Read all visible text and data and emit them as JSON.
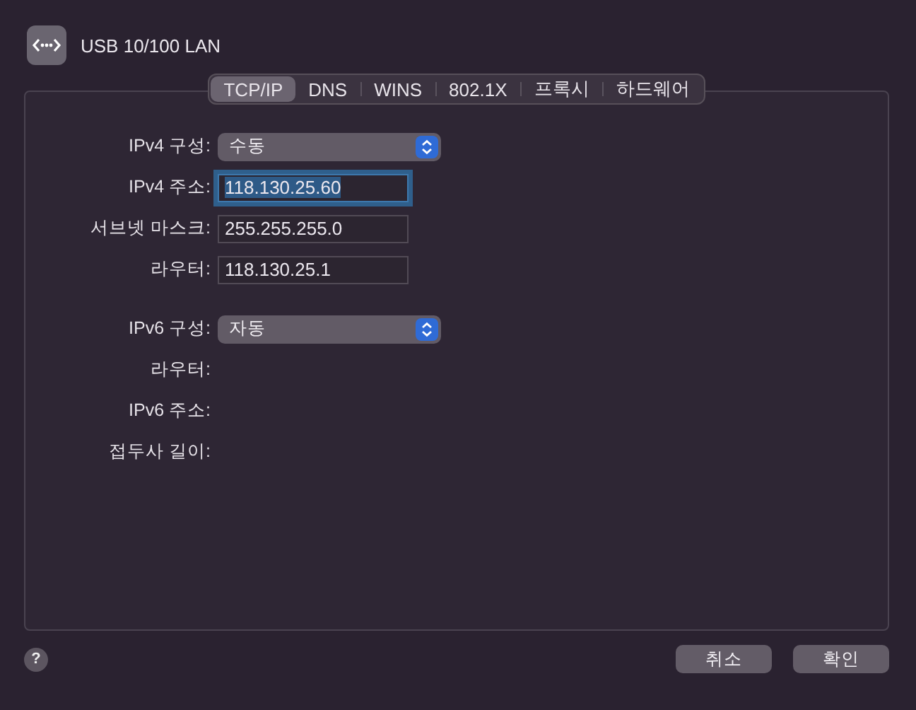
{
  "window": {
    "title": "USB 10/100 LAN"
  },
  "tabs": [
    {
      "label": "TCP/IP",
      "selected": true
    },
    {
      "label": "DNS",
      "selected": false
    },
    {
      "label": "WINS",
      "selected": false
    },
    {
      "label": "802.1X",
      "selected": false
    },
    {
      "label": "프록시",
      "selected": false
    },
    {
      "label": "하드웨어",
      "selected": false
    }
  ],
  "sections": [
    {
      "rows": [
        {
          "kind": "popup",
          "label": "IPv4 구성:",
          "value": "수동"
        },
        {
          "kind": "field",
          "label": "IPv4 주소:",
          "value": "118.130.25.60",
          "focused": true
        },
        {
          "kind": "field",
          "label": "서브넷 마스크:",
          "value": "255.255.255.0",
          "focused": false
        },
        {
          "kind": "field",
          "label": "라우터:",
          "value": "118.130.25.1",
          "focused": false
        }
      ]
    },
    {
      "rows": [
        {
          "kind": "popup",
          "label": "IPv6 구성:",
          "value": "자동"
        },
        {
          "kind": "info",
          "label": "라우터:"
        },
        {
          "kind": "info",
          "label": "IPv6 주소:"
        },
        {
          "kind": "info",
          "label": "접두사 길이:"
        }
      ]
    }
  ],
  "help": "?",
  "buttons": [
    "취소",
    "확인"
  ]
}
